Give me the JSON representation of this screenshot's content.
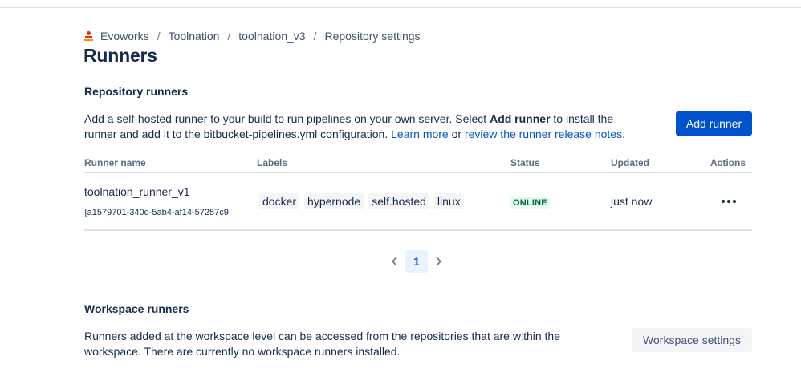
{
  "breadcrumb": {
    "workspace_icon": "workspace-logo-icon",
    "items": [
      "Evoworks",
      "Toolnation",
      "toolnation_v3",
      "Repository settings"
    ],
    "separator": "/"
  },
  "page_title": "Runners",
  "repository_runners": {
    "title": "Repository runners",
    "description": {
      "part1": "Add a self-hosted runner to your build to run pipelines on your own server. Select ",
      "bold": "Add runner",
      "part2": " to install the runner and add it to the bitbucket-pipelines.yml configuration. ",
      "link1": "Learn more",
      "part3": " or ",
      "link2": "review the runner release notes",
      "part4": "."
    },
    "add_button": "Add runner",
    "table": {
      "columns": [
        "Runner name",
        "Labels",
        "Status",
        "Updated",
        "Actions"
      ],
      "rows": [
        {
          "name": "toolnation_runner_v1",
          "uuid": "{a1579701-340d-5ab4-af14-57257c9",
          "labels": [
            "docker",
            "hypernode",
            "self.hosted",
            "linux"
          ],
          "status": "ONLINE",
          "updated": "just now",
          "actions_icon": "more-horizontal-icon"
        }
      ]
    },
    "pagination": {
      "current": "1",
      "prev_icon": "chevron-left-icon",
      "next_icon": "chevron-right-icon"
    }
  },
  "workspace_runners": {
    "title": "Workspace runners",
    "description": "Runners added at the workspace level can be accessed from the repositories that are within the workspace. There are currently no workspace runners installed.",
    "settings_button": "Workspace settings"
  },
  "colors": {
    "primary": "#0052cc",
    "text": "#172b4d",
    "subtle_text": "#5e6c84",
    "online_bg": "#e3fcef",
    "online_text": "#006644",
    "chip_bg": "#f4f5f7",
    "workspace_icon": "#de350b"
  }
}
